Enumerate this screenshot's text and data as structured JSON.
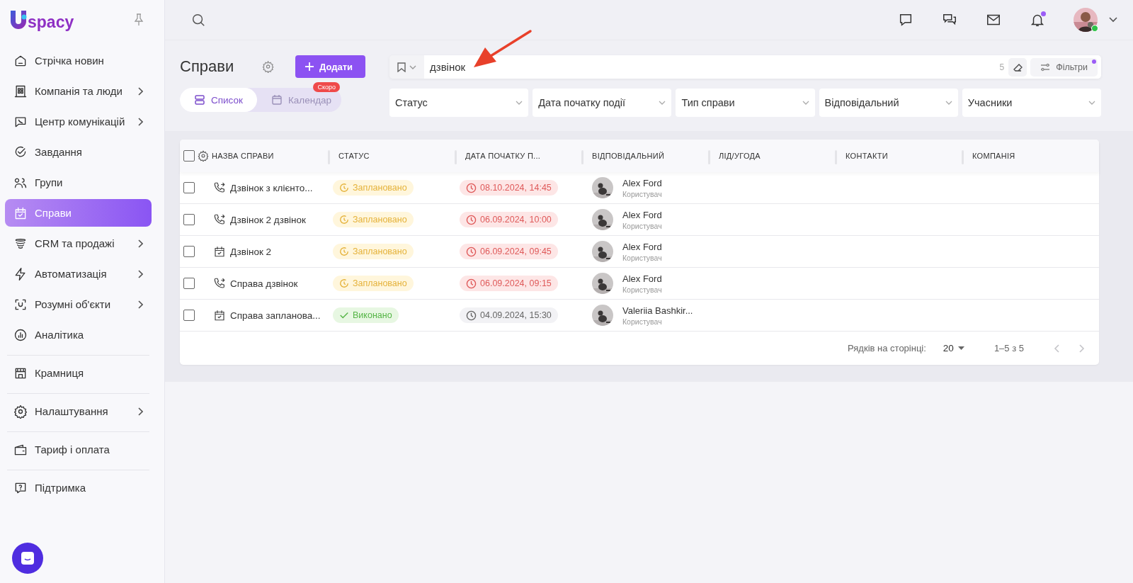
{
  "sidebar": {
    "logo_text": "spacy",
    "sections": [
      [
        {
          "label": "Стрічка новин",
          "submenu": false,
          "selected": false
        },
        {
          "label": "Компанія та люди",
          "submenu": true,
          "selected": false
        },
        {
          "label": "Центр комунікацій",
          "submenu": true,
          "selected": false
        },
        {
          "label": "Завдання",
          "submenu": false,
          "selected": false
        },
        {
          "label": "Групи",
          "submenu": false,
          "selected": false
        },
        {
          "label": "Справи",
          "submenu": false,
          "selected": true
        },
        {
          "label": "CRM та продажі",
          "submenu": true,
          "selected": false
        },
        {
          "label": "Автоматизація",
          "submenu": true,
          "selected": false
        },
        {
          "label": "Розумні об'єкти",
          "submenu": true,
          "selected": false
        },
        {
          "label": "Аналітика",
          "submenu": false,
          "selected": false
        }
      ],
      [
        {
          "label": "Крамниця",
          "submenu": false,
          "selected": false
        }
      ],
      [
        {
          "label": "Налаштування",
          "submenu": true,
          "selected": false
        }
      ],
      [
        {
          "label": "Тариф і оплата",
          "submenu": false,
          "selected": false
        }
      ],
      [
        {
          "label": "Підтримка",
          "submenu": false,
          "selected": false
        }
      ]
    ]
  },
  "topbar": {
    "notifications_unread": true,
    "user_online": true
  },
  "page": {
    "title": "Справи",
    "add_button": "Додати",
    "view_tabs": [
      {
        "label": "Список",
        "selected": true
      },
      {
        "label": "Календар",
        "selected": false,
        "badge": "Скоро"
      }
    ]
  },
  "search": {
    "value": "дзвінок",
    "count": "5",
    "filters_button": "Фільтри",
    "filters_active": true
  },
  "filters": [
    "Статус",
    "Дата початку події",
    "Тип справи",
    "Відповідальний",
    "Учасники"
  ],
  "table": {
    "all_checked": false,
    "columns": [
      "НАЗВА СПРАВИ",
      "СТАТУС",
      "ДАТА ПОЧАТКУ П...",
      "ВІДПОВІДАЛЬНИЙ",
      "ЛІД/УГОДА",
      "КОНТАКТИ",
      "КОМПАНІЯ"
    ],
    "rows": [
      {
        "checked": false,
        "kind": "call",
        "name": "Дзвінок з клієнто...",
        "status": {
          "kind": "planned",
          "label": "Заплановано"
        },
        "date": {
          "text": "08.10.2024, 14:45",
          "overdue": true
        },
        "responsible": {
          "name": "Alex Ford",
          "role": "Користувач"
        }
      },
      {
        "checked": false,
        "kind": "call",
        "name": "Дзвінок 2 дзвінок",
        "status": {
          "kind": "planned",
          "label": "Заплановано"
        },
        "date": {
          "text": "06.09.2024, 10:00",
          "overdue": true
        },
        "responsible": {
          "name": "Alex Ford",
          "role": "Користувач"
        }
      },
      {
        "checked": false,
        "kind": "meeting",
        "name": "Дзвінок 2",
        "status": {
          "kind": "planned",
          "label": "Заплановано"
        },
        "date": {
          "text": "06.09.2024, 09:45",
          "overdue": true
        },
        "responsible": {
          "name": "Alex Ford",
          "role": "Користувач"
        }
      },
      {
        "checked": false,
        "kind": "call",
        "name": "Справа дзвінок",
        "status": {
          "kind": "planned",
          "label": "Заплановано"
        },
        "date": {
          "text": "06.09.2024, 09:15",
          "overdue": true
        },
        "responsible": {
          "name": "Alex Ford",
          "role": "Користувач"
        }
      },
      {
        "checked": false,
        "kind": "meeting",
        "name": "Справа запланова...",
        "status": {
          "kind": "done",
          "label": "Виконано"
        },
        "date": {
          "text": "04.09.2024, 15:30",
          "overdue": false
        },
        "responsible": {
          "name": "Valeriia Bashkir...",
          "role": "Користувач"
        }
      }
    ],
    "pagination": {
      "rows_label": "Рядків на сторінці:",
      "rows_value": "20",
      "range": "1–5 з 5",
      "prev_disabled": true,
      "next_disabled": true
    }
  }
}
